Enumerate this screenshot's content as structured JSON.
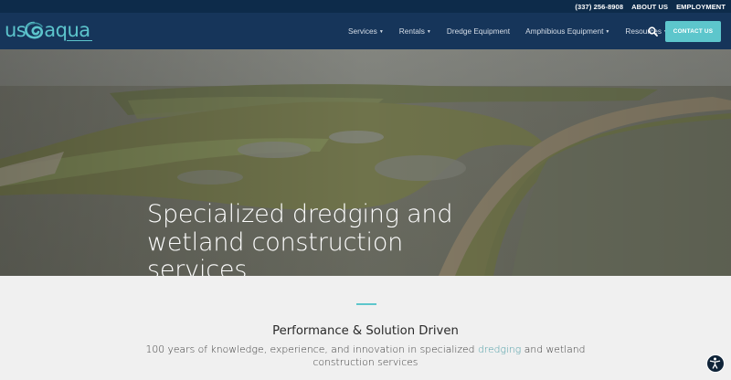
{
  "topbar": {
    "phone": "(337) 256-8908",
    "about": "ABOUT US",
    "employment": "EMPLOYMENT"
  },
  "brand": {
    "logo_left": "us",
    "logo_right": "aqua"
  },
  "nav": {
    "items": [
      {
        "label": "Services",
        "has_dropdown": true
      },
      {
        "label": "Rentals",
        "has_dropdown": true
      },
      {
        "label": "Dredge Equipment",
        "has_dropdown": false
      },
      {
        "label": "Amphibious Equipment",
        "has_dropdown": true
      },
      {
        "label": "Resources",
        "has_dropdown": true
      }
    ],
    "contact_label": "CONTACT US"
  },
  "hero": {
    "title": "Specialized dredging and wetland construction services"
  },
  "section": {
    "title": "Performance & Solution Driven",
    "subtitle_before": "100 years of knowledge, experience, and innovation in specialized ",
    "subtitle_link": "dredging",
    "subtitle_after": " and wetland construction services"
  },
  "colors": {
    "topbar_bg": "#0d2b4a",
    "nav_bg": "#16355a",
    "accent": "#5dc6cc",
    "link": "#4e9ea6"
  }
}
